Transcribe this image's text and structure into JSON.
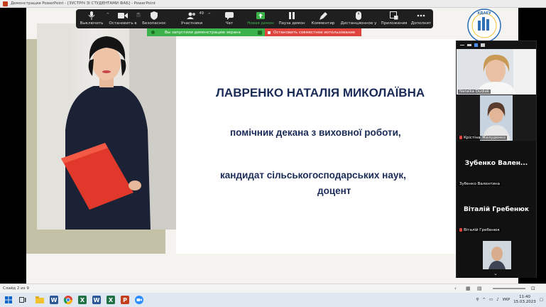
{
  "window": {
    "title": "Демонстрация PowerPoint - [ЗУСТРІЧ ЗІ СТУДЕНТАМИ ФАБ] - PowerPoint"
  },
  "toolbar": {
    "items": [
      {
        "label": "Выключить",
        "icon": "microphone-icon"
      },
      {
        "label": "Остановить в",
        "icon": "video-camera-icon"
      },
      {
        "label": "Безопаснос",
        "icon": "shield-icon"
      },
      {
        "label": "Участники",
        "icon": "participants-icon",
        "count": "49"
      },
      {
        "label": "Чат",
        "icon": "chat-icon"
      },
      {
        "label": "Новая демон",
        "icon": "share-screen-icon"
      },
      {
        "label": "Пауза демон",
        "icon": "pause-icon"
      },
      {
        "label": "Комментир",
        "icon": "annotate-pen-icon"
      },
      {
        "label": "Дистанционное у",
        "icon": "remote-control-icon"
      },
      {
        "label": "Приложения",
        "icon": "apps-icon"
      },
      {
        "label": "Дополнит",
        "icon": "more-dots-icon"
      }
    ],
    "share_banner": "Вы запустили демонстрацию экрана",
    "stop_banner": "Остановить совместное использование",
    "accent_green": "#3bb34a",
    "accent_red": "#e0453d"
  },
  "slide": {
    "name": "ЛАВРЕНКО НАТАЛІЯ МИКОЛАЇВНА",
    "role": "помічник декана з виховної роботи,",
    "degree": "кандидат сільськогосподарських наук,",
    "title": "доцент",
    "logo_text": "ХДАЕУ",
    "text_color": "#1a2b57"
  },
  "video_panel": {
    "tiles": [
      {
        "name": "Natalka Dudiak",
        "type": "video"
      },
      {
        "name": "Крістіна Желуденко",
        "type": "video",
        "muted": true
      },
      {
        "big": "Зубенко Вален...",
        "name": "Зубенко Валентина",
        "type": "name"
      },
      {
        "big": "Віталій Гребенюк",
        "name": "Віталій Гребенюк",
        "type": "name",
        "muted": true
      },
      {
        "name": "",
        "type": "video"
      }
    ]
  },
  "statusbar": {
    "slide_info": "Слайд 2 из 9"
  },
  "taskbar": {
    "lang": "УКР",
    "time": "11:40",
    "date": "15.03.2023"
  }
}
